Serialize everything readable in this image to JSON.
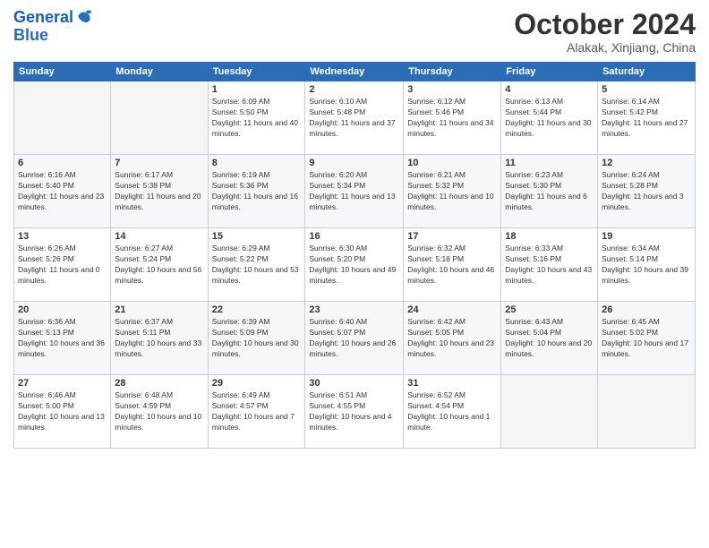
{
  "logo": {
    "line1": "General",
    "line2": "Blue"
  },
  "title": "October 2024",
  "subtitle": "Alakak, Xinjiang, China",
  "days_header": [
    "Sunday",
    "Monday",
    "Tuesday",
    "Wednesday",
    "Thursday",
    "Friday",
    "Saturday"
  ],
  "weeks": [
    [
      {
        "day": "",
        "info": ""
      },
      {
        "day": "",
        "info": ""
      },
      {
        "day": "1",
        "info": "Sunrise: 6:09 AM\nSunset: 5:50 PM\nDaylight: 11 hours and 40 minutes."
      },
      {
        "day": "2",
        "info": "Sunrise: 6:10 AM\nSunset: 5:48 PM\nDaylight: 11 hours and 37 minutes."
      },
      {
        "day": "3",
        "info": "Sunrise: 6:12 AM\nSunset: 5:46 PM\nDaylight: 11 hours and 34 minutes."
      },
      {
        "day": "4",
        "info": "Sunrise: 6:13 AM\nSunset: 5:44 PM\nDaylight: 11 hours and 30 minutes."
      },
      {
        "day": "5",
        "info": "Sunrise: 6:14 AM\nSunset: 5:42 PM\nDaylight: 11 hours and 27 minutes."
      }
    ],
    [
      {
        "day": "6",
        "info": "Sunrise: 6:16 AM\nSunset: 5:40 PM\nDaylight: 11 hours and 23 minutes."
      },
      {
        "day": "7",
        "info": "Sunrise: 6:17 AM\nSunset: 5:38 PM\nDaylight: 11 hours and 20 minutes."
      },
      {
        "day": "8",
        "info": "Sunrise: 6:19 AM\nSunset: 5:36 PM\nDaylight: 11 hours and 16 minutes."
      },
      {
        "day": "9",
        "info": "Sunrise: 6:20 AM\nSunset: 5:34 PM\nDaylight: 11 hours and 13 minutes."
      },
      {
        "day": "10",
        "info": "Sunrise: 6:21 AM\nSunset: 5:32 PM\nDaylight: 11 hours and 10 minutes."
      },
      {
        "day": "11",
        "info": "Sunrise: 6:23 AM\nSunset: 5:30 PM\nDaylight: 11 hours and 6 minutes."
      },
      {
        "day": "12",
        "info": "Sunrise: 6:24 AM\nSunset: 5:28 PM\nDaylight: 11 hours and 3 minutes."
      }
    ],
    [
      {
        "day": "13",
        "info": "Sunrise: 6:26 AM\nSunset: 5:26 PM\nDaylight: 11 hours and 0 minutes."
      },
      {
        "day": "14",
        "info": "Sunrise: 6:27 AM\nSunset: 5:24 PM\nDaylight: 10 hours and 56 minutes."
      },
      {
        "day": "15",
        "info": "Sunrise: 6:29 AM\nSunset: 5:22 PM\nDaylight: 10 hours and 53 minutes."
      },
      {
        "day": "16",
        "info": "Sunrise: 6:30 AM\nSunset: 5:20 PM\nDaylight: 10 hours and 49 minutes."
      },
      {
        "day": "17",
        "info": "Sunrise: 6:32 AM\nSunset: 5:18 PM\nDaylight: 10 hours and 46 minutes."
      },
      {
        "day": "18",
        "info": "Sunrise: 6:33 AM\nSunset: 5:16 PM\nDaylight: 10 hours and 43 minutes."
      },
      {
        "day": "19",
        "info": "Sunrise: 6:34 AM\nSunset: 5:14 PM\nDaylight: 10 hours and 39 minutes."
      }
    ],
    [
      {
        "day": "20",
        "info": "Sunrise: 6:36 AM\nSunset: 5:13 PM\nDaylight: 10 hours and 36 minutes."
      },
      {
        "day": "21",
        "info": "Sunrise: 6:37 AM\nSunset: 5:11 PM\nDaylight: 10 hours and 33 minutes."
      },
      {
        "day": "22",
        "info": "Sunrise: 6:39 AM\nSunset: 5:09 PM\nDaylight: 10 hours and 30 minutes."
      },
      {
        "day": "23",
        "info": "Sunrise: 6:40 AM\nSunset: 5:07 PM\nDaylight: 10 hours and 26 minutes."
      },
      {
        "day": "24",
        "info": "Sunrise: 6:42 AM\nSunset: 5:05 PM\nDaylight: 10 hours and 23 minutes."
      },
      {
        "day": "25",
        "info": "Sunrise: 6:43 AM\nSunset: 5:04 PM\nDaylight: 10 hours and 20 minutes."
      },
      {
        "day": "26",
        "info": "Sunrise: 6:45 AM\nSunset: 5:02 PM\nDaylight: 10 hours and 17 minutes."
      }
    ],
    [
      {
        "day": "27",
        "info": "Sunrise: 6:46 AM\nSunset: 5:00 PM\nDaylight: 10 hours and 13 minutes."
      },
      {
        "day": "28",
        "info": "Sunrise: 6:48 AM\nSunset: 4:59 PM\nDaylight: 10 hours and 10 minutes."
      },
      {
        "day": "29",
        "info": "Sunrise: 6:49 AM\nSunset: 4:57 PM\nDaylight: 10 hours and 7 minutes."
      },
      {
        "day": "30",
        "info": "Sunrise: 6:51 AM\nSunset: 4:55 PM\nDaylight: 10 hours and 4 minutes."
      },
      {
        "day": "31",
        "info": "Sunrise: 6:52 AM\nSunset: 4:54 PM\nDaylight: 10 hours and 1 minute."
      },
      {
        "day": "",
        "info": ""
      },
      {
        "day": "",
        "info": ""
      }
    ]
  ]
}
